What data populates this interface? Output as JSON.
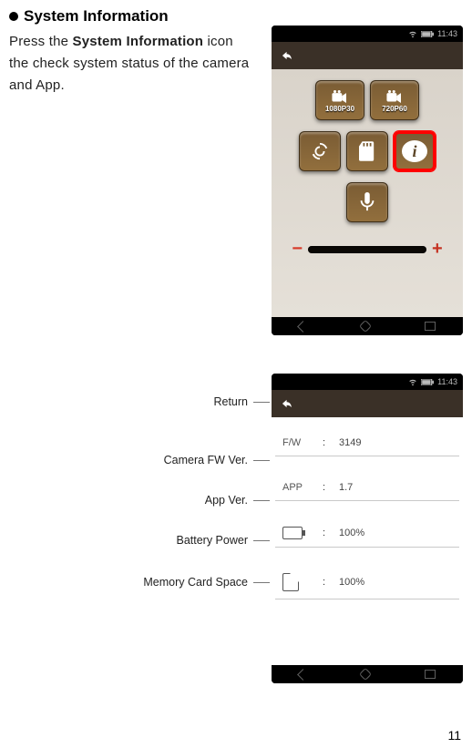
{
  "heading": "System Information",
  "intro": {
    "pre": "Press the ",
    "bold": "System Information",
    "post": " icon the check system status of the camera and App."
  },
  "phone": {
    "status_time": "11:43",
    "tiles": {
      "res1": "1080P30",
      "res2": "720P60"
    },
    "slider": {
      "minus": "−",
      "plus": "+"
    }
  },
  "phone2": {
    "status_time": "11:43",
    "rows": {
      "fw_key": "F/W",
      "fw_val": "3149",
      "app_key": "APP",
      "app_val": "1.7",
      "bat_val": "100%",
      "sd_val": "100%"
    }
  },
  "callouts": {
    "return": "Return",
    "fw": "Camera FW Ver.",
    "app": "App Ver.",
    "bat": "Battery Power",
    "sd": "Memory Card Space"
  },
  "page_number": "11"
}
